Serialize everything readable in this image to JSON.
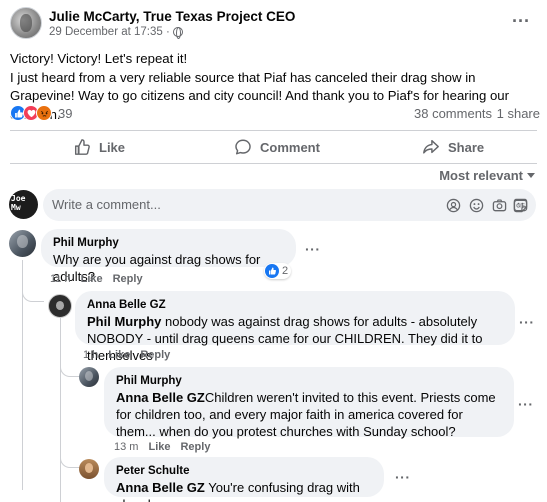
{
  "post": {
    "author": "Julie McCarty, True Texas Project CEO",
    "timestamp": "29 December at 17:35 ·",
    "body_lines": [
      "Victory! Victory! Let's repeat it!",
      "I just heard from a very reliable source that Piaf has canceled their drag show in Grapevine! Way to go citizens and city council! And thank you to Piaf's for hearing our concern."
    ],
    "reaction_count": "39",
    "comments_count": "38 comments",
    "shares_count": "1 share"
  },
  "actions": {
    "like": "Like",
    "comment": "Comment",
    "share": "Share"
  },
  "sort_label": "Most relevant",
  "composer": {
    "placeholder": "Write a comment...",
    "avatar_text": "Joe Mw"
  },
  "comments": [
    {
      "author": "Phil Murphy",
      "text": "Why are you against drag shows for adults?",
      "time": "11 h",
      "like": "Like",
      "reply": "Reply",
      "reply_count": "2"
    },
    {
      "author": "Anna Belle GZ",
      "mention": "Phil Murphy",
      "text": " nobody was against drag shows for adults - absolutely NOBODY - until drag queens came for our CHILDREN. They did it to themselves",
      "time": "1 h",
      "like": "Like",
      "reply": "Reply"
    },
    {
      "author": "Phil Murphy",
      "mention": "Anna Belle GZ",
      "text": "Children weren't invited to this event. Priests come for children too, and every major faith in america covered for them... when do you protest churches with Sunday school?",
      "time": "13 m",
      "like": "Like",
      "reply": "Reply"
    },
    {
      "author": "Peter Schulte",
      "mention": "Anna Belle GZ",
      "text": " You're confusing drag with church"
    }
  ],
  "colors": {
    "like_blue": "#1877f2",
    "love_red": "#f33e58",
    "angry_orange": "#e9710f",
    "meta_gray": "#65676b",
    "bubble_bg": "#f0f2f5"
  }
}
